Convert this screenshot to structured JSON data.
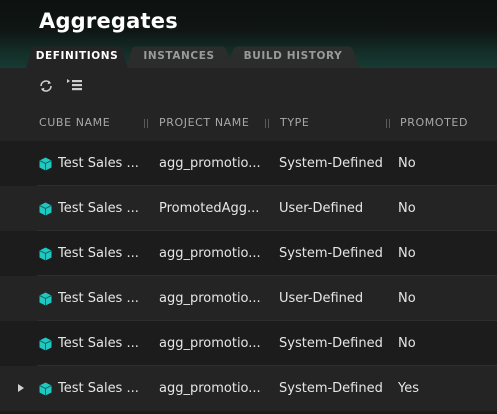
{
  "page": {
    "title": "Aggregates"
  },
  "tabs": [
    {
      "label": "DEFINITIONS",
      "active": true
    },
    {
      "label": "INSTANCES",
      "active": false
    },
    {
      "label": "BUILD HISTORY",
      "active": false
    }
  ],
  "toolbar": {
    "refresh_icon": "refresh-icon",
    "collapse_icon": "collapse-list-icon"
  },
  "table": {
    "columns": [
      "CUBE NAME",
      "PROJECT NAME",
      "TYPE",
      "PROMOTED"
    ],
    "rows": [
      {
        "cube": "Test Sales ...",
        "project": "agg_promotio...",
        "type": "System-Defined",
        "promoted": "No"
      },
      {
        "cube": "Test Sales ...",
        "project": "PromotedAgg...",
        "type": "User-Defined",
        "promoted": "No"
      },
      {
        "cube": "Test Sales ...",
        "project": "agg_promotio...",
        "type": "System-Defined",
        "promoted": "No"
      },
      {
        "cube": "Test Sales ...",
        "project": "agg_promotio...",
        "type": "User-Defined",
        "promoted": "No"
      },
      {
        "cube": "Test Sales ...",
        "project": "agg_promotio...",
        "type": "System-Defined",
        "promoted": "No"
      },
      {
        "cube": "Test Sales ...",
        "project": "agg_promotio...",
        "type": "System-Defined",
        "promoted": "Yes"
      }
    ]
  },
  "colors": {
    "accent": "#1fc8c0",
    "background": "#1c1c1c",
    "header_gradient_end": "#173a33"
  }
}
